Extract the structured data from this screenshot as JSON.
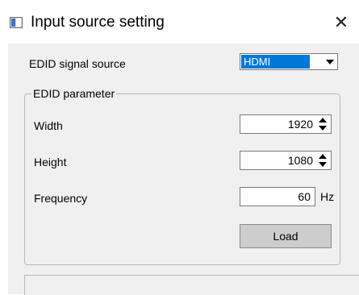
{
  "window": {
    "title": "Input source setting",
    "close_glyph": "✕"
  },
  "edid_source": {
    "label": "EDID signal source",
    "selected": "HDMI"
  },
  "parameters": {
    "group_title": "EDID parameter",
    "width": {
      "label": "Width",
      "value": "1920"
    },
    "height": {
      "label": "Height",
      "value": "1080"
    },
    "frequency": {
      "label": "Frequency",
      "value": "60",
      "unit": "Hz"
    }
  },
  "actions": {
    "load_label": "Load"
  },
  "icons": [
    "app-icon",
    "close-icon",
    "dropdown-arrow-icon",
    "spin-up-icon",
    "spin-down-icon"
  ],
  "colors": {
    "selection": "#0078d7",
    "client_bg": "#f0f0f0",
    "button_bg": "#cdcdcd"
  }
}
